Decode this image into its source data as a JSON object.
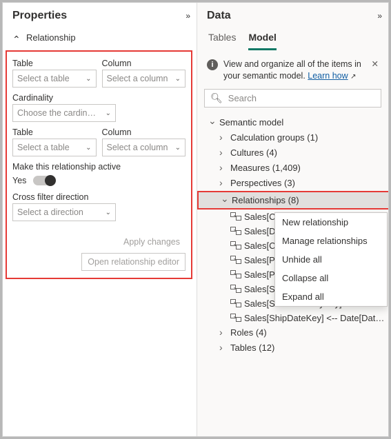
{
  "properties": {
    "title": "Properties",
    "section": "Relationship",
    "fields": {
      "table_label": "Table",
      "column_label": "Column",
      "select_table_ph": "Select a table",
      "select_column_ph": "Select a column",
      "cardinality_label": "Cardinality",
      "cardinality_ph": "Choose the cardin…",
      "active_label": "Make this relationship active",
      "active_value": "Yes",
      "cross_label": "Cross filter direction",
      "cross_ph": "Select a direction"
    },
    "buttons": {
      "apply": "Apply changes",
      "open_editor": "Open relationship editor"
    }
  },
  "data": {
    "title": "Data",
    "tabs": {
      "tables": "Tables",
      "model": "Model"
    },
    "info_text1": "View and organize all of the items in your semantic model. ",
    "info_link": "Learn how",
    "search_ph": "Search",
    "tree": {
      "root": "Semantic model",
      "calc_groups": "Calculation groups (1)",
      "cultures": "Cultures (4)",
      "measures": "Measures (1,409)",
      "perspectives": "Perspectives (3)",
      "relationships": "Relationships (8)",
      "roles": "Roles (4)",
      "tables": "Tables (12)",
      "rel_items": [
        "Sales[C",
        "Sales[D",
        "Sales[C",
        "Sales[P",
        "Sales[P",
        "Sales[SalesOrderLineKey] — Sales Or…",
        "Sales[SalesTerritoryKey] <- Sales Te…",
        "Sales[ShipDateKey] <-- Date[DateKey]"
      ]
    },
    "context_menu": [
      "New relationship",
      "Manage relationships",
      "Unhide all",
      "Collapse all",
      "Expand all"
    ]
  }
}
